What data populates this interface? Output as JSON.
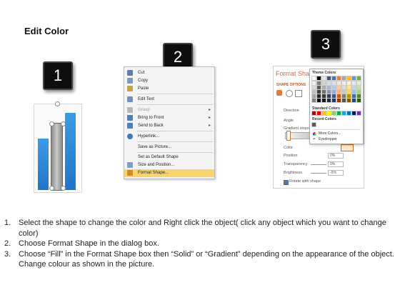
{
  "title": "Edit Color",
  "badges": [
    "1",
    "2",
    "3"
  ],
  "context_menu": {
    "items": [
      {
        "label": "Cut",
        "icon": "scissors-icon",
        "disabled": false
      },
      {
        "label": "Copy",
        "icon": "copy-icon",
        "disabled": false
      },
      {
        "label": "Paste",
        "icon": "paste-icon",
        "disabled": false
      },
      {
        "label": "Edit Text",
        "icon": "edit-text-icon",
        "disabled": false
      },
      {
        "label": "Group",
        "icon": "group-icon",
        "disabled": true
      },
      {
        "label": "Bring to Front",
        "icon": "bring-to-front-icon",
        "disabled": false
      },
      {
        "label": "Send to Back",
        "icon": "send-to-back-icon",
        "disabled": false
      },
      {
        "label": "Hyperlink...",
        "icon": "hyperlink-icon",
        "disabled": false
      },
      {
        "label": "Save as Picture...",
        "icon": "",
        "disabled": false
      },
      {
        "label": "Set as Default Shape",
        "icon": "",
        "disabled": false
      },
      {
        "label": "Size and Position...",
        "icon": "size-icon",
        "disabled": false
      },
      {
        "label": "Format Shape...",
        "icon": "format-shape-icon",
        "disabled": false
      }
    ]
  },
  "format_pane": {
    "title": "Format Shape",
    "tab": "SHAPE OPTIONS",
    "rows": {
      "direction": "Direction",
      "angle": "Angle",
      "gradient_stops": "Gradient stops",
      "color": "Color",
      "position": "Position",
      "transparency": "Transparency",
      "brightness": "Brightness",
      "rotate": "Rotate with shape"
    },
    "values": {
      "position": "0%",
      "transparency": "0%",
      "brightness": "-5%"
    }
  },
  "palette": {
    "theme_label": "Theme Colors",
    "standard_label": "Standard Colors",
    "recent_label": "Recent Colors",
    "more_colors": "More Colors...",
    "eyedropper": "Eyedropper",
    "theme_top": [
      "#ffffff",
      "#000000",
      "#e7e6e6",
      "#44546a",
      "#4472c4",
      "#ed7d31",
      "#a5a5a5",
      "#ffc000",
      "#5b9bd5",
      "#70ad47"
    ],
    "theme_cols": [
      [
        "#f2f2f2",
        "#d9d9d9",
        "#bfbfbf",
        "#a6a6a6",
        "#7f7f7f"
      ],
      [
        "#7f7f7f",
        "#595959",
        "#404040",
        "#262626",
        "#0d0d0d"
      ],
      [
        "#d0cece",
        "#aeabab",
        "#757070",
        "#3a3838",
        "#171616"
      ],
      [
        "#d6dce4",
        "#adb9ca",
        "#8497b0",
        "#333f4f",
        "#222a35"
      ],
      [
        "#dae3f3",
        "#b4c7e7",
        "#8faadc",
        "#2f5597",
        "#203864"
      ],
      [
        "#fbe5d6",
        "#f8cbad",
        "#f4b183",
        "#c55a11",
        "#843c0c"
      ],
      [
        "#ededed",
        "#dbdbdb",
        "#c9c9c9",
        "#7b7b7b",
        "#525252"
      ],
      [
        "#fff2cc",
        "#ffe699",
        "#ffd966",
        "#bf9000",
        "#7f6000"
      ],
      [
        "#deebf7",
        "#bdd7ee",
        "#9dc3e6",
        "#2e75b6",
        "#1f4e79"
      ],
      [
        "#e2f0d9",
        "#c5e0b4",
        "#a9d18e",
        "#548235",
        "#385723"
      ]
    ],
    "standard": [
      "#c00000",
      "#ff0000",
      "#ffc000",
      "#ffff00",
      "#92d050",
      "#00b050",
      "#00b0f0",
      "#0070c0",
      "#002060",
      "#7030a0"
    ],
    "recent": [
      "#595959"
    ]
  },
  "instructions": [
    {
      "num": "1.",
      "text": "Select the shape to change the color and Right click the object( click any object which you want to change color)"
    },
    {
      "num": "2.",
      "text": "Choose Format Shape in the dialog box."
    },
    {
      "num": "3.",
      "text": "Choose “Fill” in the Format Shape box then “Solid” or “Gradient” depending on the appearance of the object. Change colour as shown in the picture."
    }
  ]
}
